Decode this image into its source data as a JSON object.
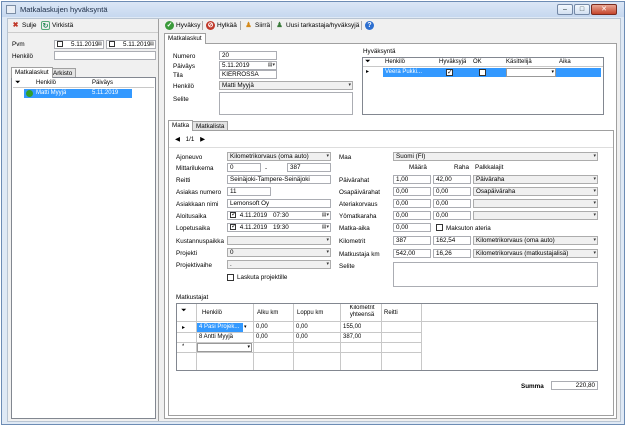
{
  "window": {
    "title": "Matkalaskujen hyväksyntä",
    "min": "–",
    "max": "□",
    "close": "✕"
  },
  "left_toolbar": {
    "close_label": "Sulje",
    "refresh_label": "Virkistä"
  },
  "filter": {
    "date_label": "Pvm",
    "date_from": "5.11.2019",
    "date_to": "5.11.2019",
    "person_label": "Henkilö",
    "person_value": ""
  },
  "left_tabs": [
    "Matkalaskut",
    "Arkisto"
  ],
  "left_grid": {
    "headers": [
      "Henkilö",
      "Päiväys"
    ],
    "rows": [
      {
        "person": "Matti Myyjä",
        "date": "5.11.2019"
      }
    ]
  },
  "right_toolbar": {
    "approve": "Hyväksy",
    "reject": "Hylkää",
    "transfer": "Siirrä",
    "new_approver": "Uusi tarkastaja/hyväksyjä",
    "help": "?"
  },
  "main_tab": "Matkalaskut",
  "header_form": {
    "number_label": "Numero",
    "number": "20",
    "date_label": "Päiväys",
    "date": "5.11.2019",
    "state_label": "Tila",
    "state": "KIERROSSA",
    "person_label": "Henkilö",
    "person": "Matti Myyjä",
    "desc_label": "Selite",
    "desc": ""
  },
  "approval": {
    "title": "Hyväksyntä",
    "headers": [
      "Henkilö",
      "Hyväksyjä",
      "OK",
      "Käsittelijä",
      "Aika"
    ],
    "rows": [
      {
        "person": "Veera Pukki...",
        "approver": true,
        "ok": false,
        "handler": "",
        "time": ""
      }
    ]
  },
  "sub_tabs": [
    "Matka",
    "Matkalista"
  ],
  "nav": {
    "first": "◀",
    "counter": "1/1",
    "last": "▶"
  },
  "trip": {
    "vehicle_label": "Ajoneuvo",
    "vehicle": "Kilometrikorvaus (oma auto)",
    "odometer_label": "Mittarilukema",
    "odo_from": "0",
    "odo_sep": "-",
    "odo_to": "387",
    "route_label": "Reitti",
    "route": "Seinäjoki-Tampere-Seinäjoki",
    "cust_no_label": "Asiakas numero",
    "cust_no": "11",
    "cust_name_label": "Asiakkaan nimi",
    "cust_name": "Lemonsoft Oy",
    "start_label": "Aloitusaika",
    "start": "4.11.2019",
    "start_time": "07:30",
    "end_label": "Lopetusaika",
    "end": "4.11.2019",
    "end_time": "19:30",
    "cost_center_label": "Kustannuspaikka",
    "cost_center": "",
    "project_label": "Projekti",
    "project": "0",
    "project_phase_label": "Projektivaihe",
    "project_phase": ".",
    "invoice_project_label": "Laskuta projektille"
  },
  "allowances": {
    "country_label": "Maa",
    "country": "Suomi (FI)",
    "col_qty": "Määrä",
    "col_money": "Raha",
    "col_type": "Palkkalajit",
    "rows": [
      {
        "label": "Päivärahat",
        "qty": "1,00",
        "money": "42,00",
        "type": "Päiväraha"
      },
      {
        "label": "Osapäivärahat",
        "qty": "0,00",
        "money": "0,00",
        "type": "Osapäiväraha"
      },
      {
        "label": "Ateriakorvaus",
        "qty": "0,00",
        "money": "0,00",
        "type": ""
      },
      {
        "label": "Yömatkaraha",
        "qty": "0,00",
        "money": "0,00",
        "type": ""
      }
    ],
    "trip_time_label": "Matka-aika",
    "trip_time": "0,00",
    "free_meal_label": "Maksuton ateria",
    "km_label": "Kilometrit",
    "km_qty": "387",
    "km_money": "162,54",
    "km_type": "Kilometrikorvaus (oma auto)",
    "passenger_label": "Matkustaja km",
    "pass_qty": "542,00",
    "pass_money": "16,26",
    "pass_type": "Kilometrikorvaus (matkustajalisä)",
    "desc_label": "Selite"
  },
  "passengers": {
    "title": "Matkustajat",
    "headers": [
      "Henkilö",
      "Alku km",
      "Loppu km",
      "Kilometrit yhteensä",
      "Reitti"
    ],
    "rows": [
      {
        "person": "4 Pasi Projek...",
        "start": "0,00",
        "end": "0,00",
        "total": "155,00",
        "route": ""
      },
      {
        "person": "8 Antti Myyjä",
        "start": "0,00",
        "end": "0,00",
        "total": "387,00",
        "route": ""
      }
    ],
    "new_row_marker": "*"
  },
  "total": {
    "label": "Summa",
    "value": "220,80"
  },
  "colors": {
    "selection": "#3399ff",
    "titlebar": "#c6d8ef",
    "status_green": "#33a02c"
  }
}
